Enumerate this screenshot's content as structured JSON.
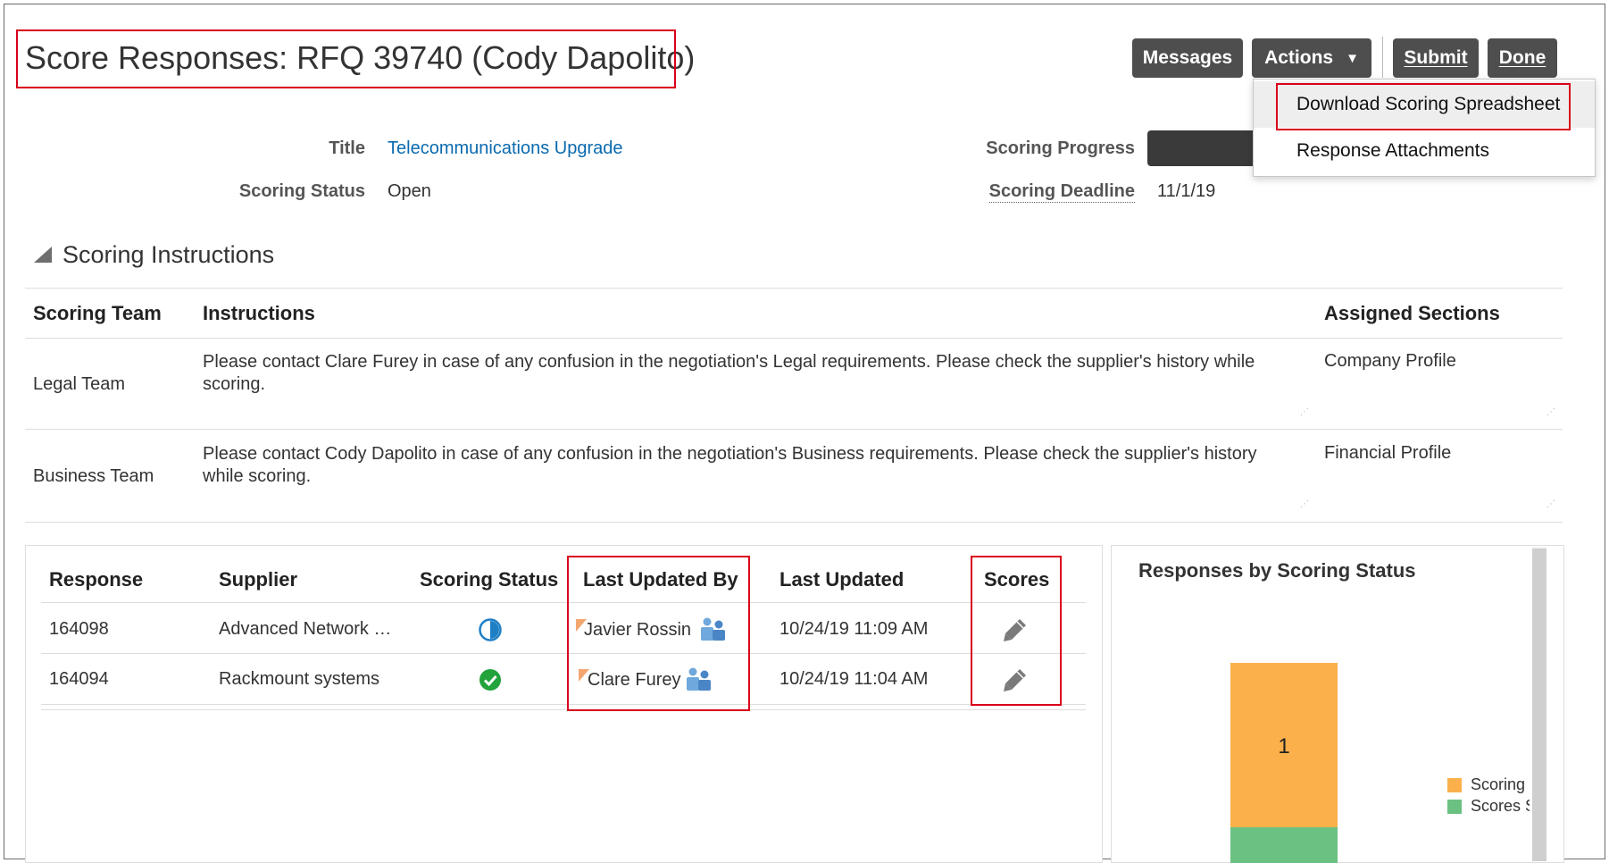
{
  "header": {
    "title": "Score Responses: RFQ 39740 (Cody Dapolito)"
  },
  "toolbar": {
    "messages_label": "Messages",
    "actions_label": "Actions",
    "submit_label": "Submit",
    "done_label": "Done"
  },
  "actions_menu": {
    "items": [
      {
        "label": "Download Scoring Spreadsheet"
      },
      {
        "label": "Response Attachments"
      }
    ]
  },
  "summary": {
    "title_label": "Title",
    "title_value": "Telecommunications Upgrade",
    "status_label": "Scoring Status",
    "status_value": "Open",
    "progress_label": "Scoring Progress",
    "deadline_label": "Scoring Deadline",
    "deadline_value": "11/1/19"
  },
  "instructions": {
    "section_title": "Scoring Instructions",
    "columns": {
      "team": "Scoring Team",
      "instructions": "Instructions",
      "sections": "Assigned Sections"
    },
    "rows": [
      {
        "team": "Legal Team",
        "instructions": "Please contact Clare Furey in case of any confusion in the negotiation's Legal requirements. Please check the supplier's history while scoring.",
        "sections": "Company Profile"
      },
      {
        "team": "Business Team",
        "instructions": "Please contact Cody Dapolito in case of any confusion in the negotiation's Business requirements. Please check the supplier's history while scoring.",
        "sections": "Financial Profile"
      }
    ]
  },
  "responses": {
    "columns": {
      "response": "Response",
      "supplier": "Supplier",
      "status": "Scoring Status",
      "updated_by": "Last Updated By",
      "updated": "Last Updated",
      "scores": "Scores"
    },
    "rows": [
      {
        "response": "164098",
        "supplier": "Advanced Network …",
        "status": "in-progress-icon",
        "updated_by": "Javier Rossin",
        "updated": "10/24/19 11:09 AM"
      },
      {
        "response": "164094",
        "supplier": "Rackmount systems",
        "status": "complete-check-icon",
        "updated_by": "Clare Furey",
        "updated": "10/24/19 11:04 AM"
      }
    ]
  },
  "chart_data": {
    "type": "bar",
    "title": "Responses by Scoring Status",
    "series": [
      {
        "name": "Scoring",
        "values": [
          1
        ],
        "color": "#fbb04b"
      },
      {
        "name": "Scores",
        "values": [
          1
        ],
        "color": "#6bc181"
      }
    ],
    "data_labels": [
      "1"
    ],
    "legend_placement": "right"
  },
  "colors": {
    "link": "#0a6ab0",
    "button": "#4e4e4e",
    "highlight": "#d9001b",
    "in_progress": "#1f7fc5",
    "complete": "#22a33c"
  }
}
